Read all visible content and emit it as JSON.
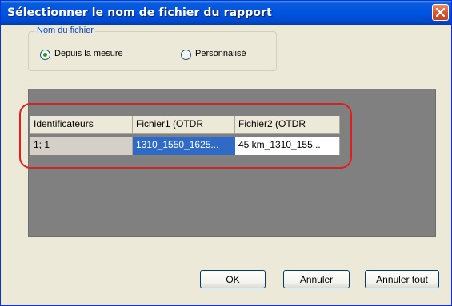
{
  "window": {
    "title": "Sélectionner le nom de fichier du rapport"
  },
  "filename_group": {
    "legend": "Nom du fichier",
    "options": [
      {
        "label": "Depuis la mesure",
        "selected": true
      },
      {
        "label": "Personnalisé",
        "selected": false
      }
    ]
  },
  "grid": {
    "headers": [
      "Identificateurs",
      "Fichier1 (OTDR",
      "Fichier2 (OTDR"
    ],
    "rows": [
      [
        "1; 1",
        "1310_1550_1625...",
        "45 km_1310_155..."
      ]
    ]
  },
  "buttons": {
    "ok": "OK",
    "cancel": "Annuler",
    "cancel_all": "Annuler tout"
  },
  "colors": {
    "title_bar": "#0054e3",
    "selection": "#316ac5",
    "highlight": "#e01e1e",
    "group_legend": "#0046d5"
  }
}
